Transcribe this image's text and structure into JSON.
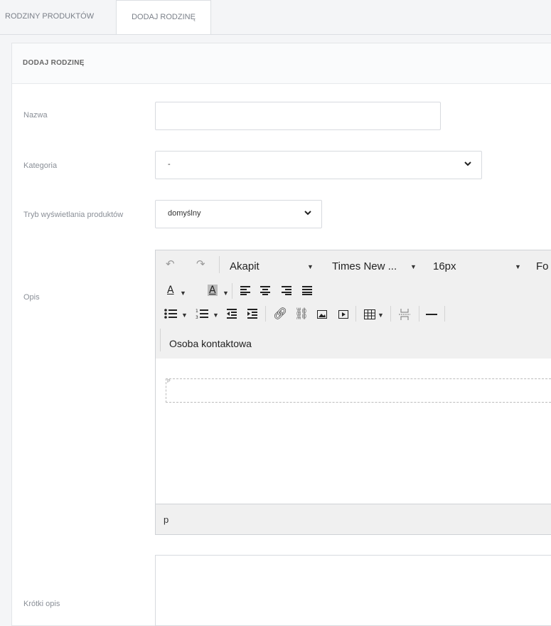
{
  "tabs": [
    "RODZINY PRODUKTÓW",
    "DODAJ RODZINĘ"
  ],
  "panel": {
    "title": "DODAJ RODZINĘ"
  },
  "form": {
    "name_label": "Nazwa",
    "name_value": "",
    "category_label": "Kategoria",
    "category_value": "-",
    "mode_label": "Tryb wyświetlania produktów",
    "mode_value": "domyślny",
    "desc_label": "Opis",
    "short_label": "Krótki opis"
  },
  "editor": {
    "format": "Akapit",
    "font": "Times New ...",
    "size": "16px",
    "more": "Fo",
    "custom_button": "Osoba kontaktowa",
    "status_path": "p"
  },
  "icons": [
    "undo-icon",
    "redo-icon",
    "text-color-icon",
    "bg-color-icon",
    "align-left-icon",
    "align-center-icon",
    "align-right-icon",
    "align-justify-icon",
    "bullet-list-icon",
    "numbered-list-icon",
    "outdent-icon",
    "indent-icon",
    "link-icon",
    "unlink-icon",
    "image-icon",
    "media-icon",
    "table-icon",
    "page-break-icon",
    "horizontal-rule-icon",
    "chevron-down-icon"
  ]
}
